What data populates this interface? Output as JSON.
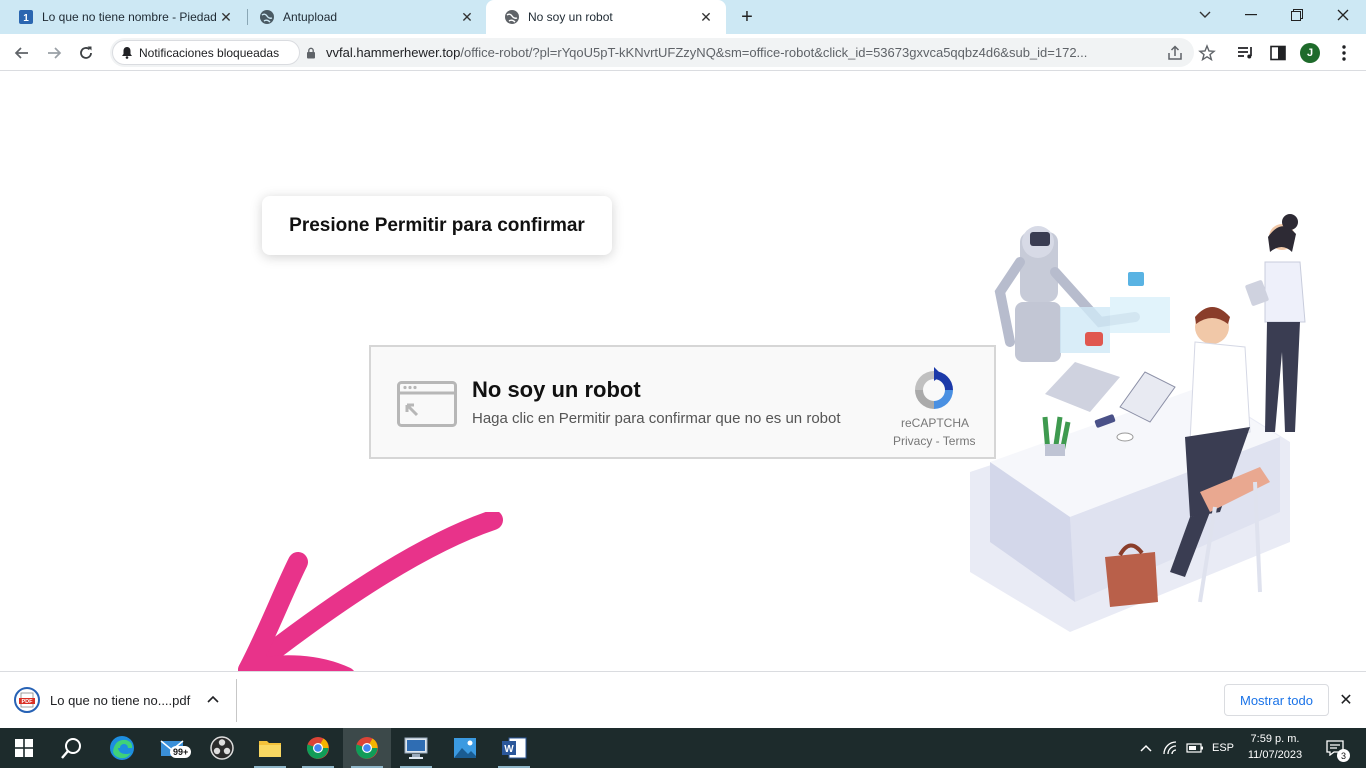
{
  "browser": {
    "tabs": [
      {
        "title": "Lo que no tiene nombre - Piedad",
        "close": "✕"
      },
      {
        "title": "Antupload",
        "close": "✕"
      },
      {
        "title": "No soy un robot",
        "close": "✕"
      }
    ],
    "new_tab": "+",
    "window_controls": {
      "tab_search": "⌄",
      "minimize": "—",
      "restore": "❐",
      "close": "✕"
    },
    "notification_chip": "Notificaciones bloqueadas",
    "url_host": "vvfal.hammerhewer.top",
    "url_rest": "/office-robot/?pl=rYqoU5pT-kKNvrtUFZzyNQ&sm=office-robot&click_id=53673gxvca5qqbz4d6&sub_id=172...",
    "profile_initial": "J"
  },
  "page": {
    "confirm_text": "Presione Permitir para confirmar",
    "captcha": {
      "title": "No soy un robot",
      "subtitle": "Haga clic en Permitir para confirmar que no es un robot",
      "brand": "reCAPTCHA",
      "privacy": "Privacy - Terms"
    }
  },
  "downloads": {
    "file_name": "Lo que no tiene no....pdf",
    "show_all": "Mostrar todo",
    "close": "✕"
  },
  "taskbar": {
    "mail_badge": "99+",
    "language": "ESP",
    "time": "7:59 p. m.",
    "date": "11/07/2023",
    "notifications": "3"
  },
  "colors": {
    "tabstrip": "#cde8f4",
    "arrow": "#e8338a",
    "taskbar": "#1d2b2c",
    "link": "#1a73e8"
  }
}
